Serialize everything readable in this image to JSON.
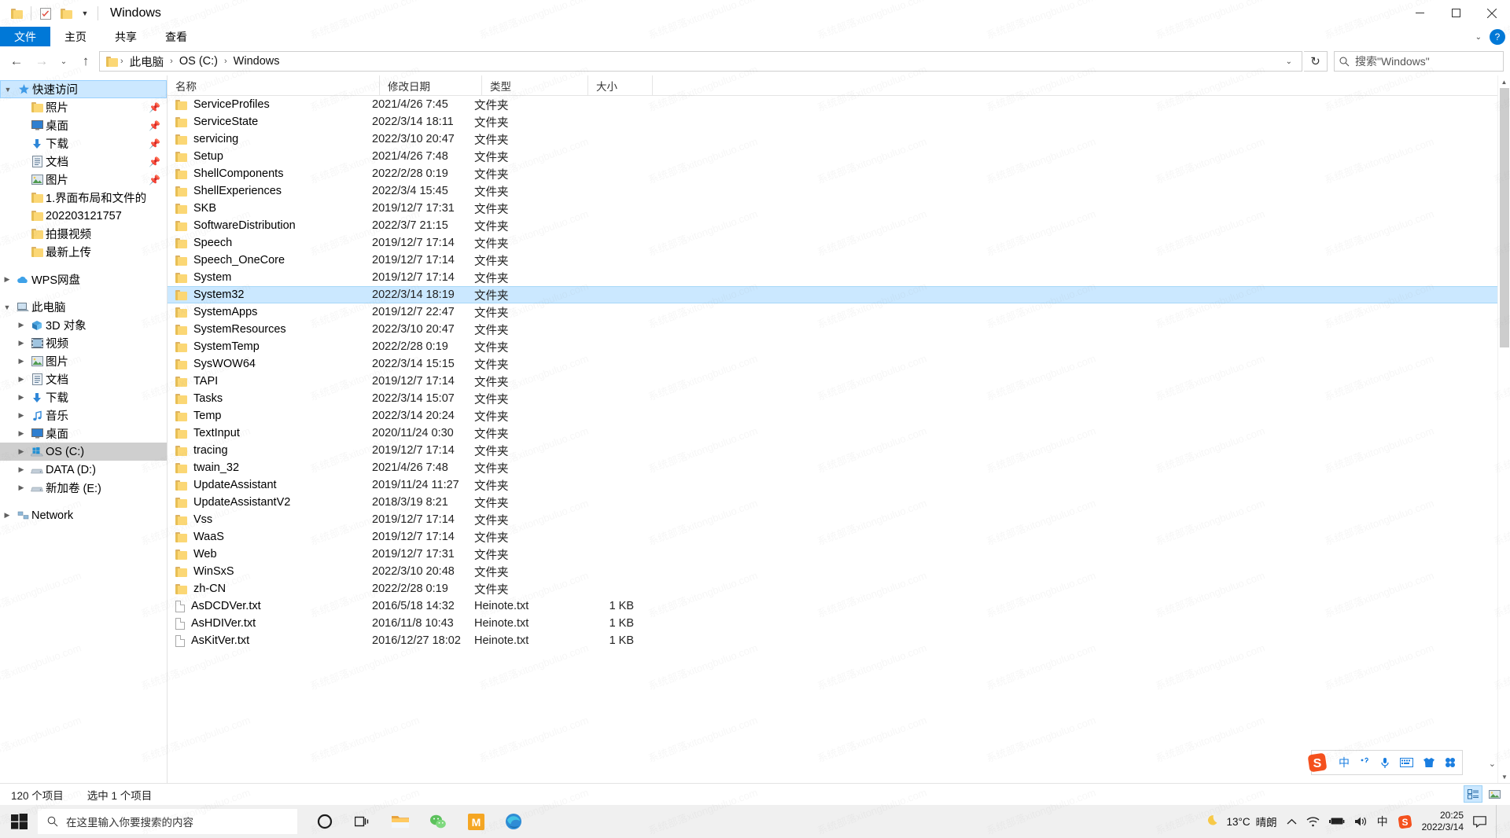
{
  "window": {
    "title": "Windows",
    "quick_access_toolbar": [
      {
        "name": "properties-icon",
        "glyph": "folder"
      },
      {
        "name": "new-folder-icon",
        "glyph": "checklist"
      },
      {
        "name": "folder-icon",
        "glyph": "folder"
      }
    ],
    "controls": {
      "minimize": "─",
      "maximize": "☐",
      "close": "✕"
    }
  },
  "ribbon": {
    "tabs": [
      {
        "label": "文件",
        "active": true
      },
      {
        "label": "主页",
        "active": false
      },
      {
        "label": "共享",
        "active": false
      },
      {
        "label": "查看",
        "active": false
      }
    ],
    "collapse_glyph": "⌄",
    "help_glyph": "?"
  },
  "address": {
    "back": "←",
    "forward": "→",
    "recent": "⌄",
    "up": "↑",
    "breadcrumbs": [
      "此电脑",
      "OS (C:)",
      "Windows"
    ],
    "separator": "›",
    "dropdown": "⌄",
    "refresh": "↻",
    "search_placeholder": "搜索\"Windows\""
  },
  "sidebar": {
    "groups": [
      {
        "name": "quick-access",
        "label": "快速访问",
        "icon": "star-icon",
        "expanded": true,
        "selected": true,
        "items": [
          {
            "label": "照片",
            "icon": "folder-icon",
            "pinned": true
          },
          {
            "label": "桌面",
            "icon": "desktop-icon",
            "pinned": true
          },
          {
            "label": "下载",
            "icon": "download-icon",
            "pinned": true
          },
          {
            "label": "文档",
            "icon": "document-icon",
            "pinned": true
          },
          {
            "label": "图片",
            "icon": "pictures-icon",
            "pinned": true
          },
          {
            "label": "1.界面布局和文件的",
            "icon": "folder-icon",
            "pinned": false
          },
          {
            "label": "202203121757",
            "icon": "folder-icon",
            "pinned": false
          },
          {
            "label": "拍摄视频",
            "icon": "folder-icon",
            "pinned": false
          },
          {
            "label": "最新上传",
            "icon": "folder-icon",
            "pinned": false
          }
        ]
      },
      {
        "name": "wps-cloud",
        "label": "WPS网盘",
        "icon": "cloud-icon",
        "expanded": false,
        "items": []
      },
      {
        "name": "this-pc",
        "label": "此电脑",
        "icon": "computer-icon",
        "expanded": true,
        "items": [
          {
            "label": "3D 对象",
            "icon": "3d-objects-icon",
            "chevron": true
          },
          {
            "label": "视频",
            "icon": "videos-icon",
            "chevron": true
          },
          {
            "label": "图片",
            "icon": "pictures-icon",
            "chevron": true
          },
          {
            "label": "文档",
            "icon": "document-icon",
            "chevron": true
          },
          {
            "label": "下载",
            "icon": "download-icon",
            "chevron": true
          },
          {
            "label": "音乐",
            "icon": "music-icon",
            "chevron": true
          },
          {
            "label": "桌面",
            "icon": "desktop-icon",
            "chevron": true
          },
          {
            "label": "OS (C:)",
            "icon": "windows-drive-icon",
            "chevron": true,
            "selected": true
          },
          {
            "label": "DATA (D:)",
            "icon": "drive-icon",
            "chevron": true
          },
          {
            "label": "新加卷 (E:)",
            "icon": "drive-icon",
            "chevron": true
          }
        ]
      },
      {
        "name": "network",
        "label": "Network",
        "icon": "network-icon",
        "expanded": false,
        "items": []
      }
    ]
  },
  "filelist": {
    "columns": [
      {
        "key": "name",
        "label": "名称",
        "sorted": true,
        "sort_dir": "asc"
      },
      {
        "key": "date",
        "label": "修改日期"
      },
      {
        "key": "type",
        "label": "类型"
      },
      {
        "key": "size",
        "label": "大小"
      }
    ],
    "sort_glyph": "▲",
    "rows": [
      {
        "name": "ServiceProfiles",
        "date": "2021/4/26 7:45",
        "type": "文件夹",
        "size": "",
        "kind": "folder"
      },
      {
        "name": "ServiceState",
        "date": "2022/3/14 18:11",
        "type": "文件夹",
        "size": "",
        "kind": "folder"
      },
      {
        "name": "servicing",
        "date": "2022/3/10 20:47",
        "type": "文件夹",
        "size": "",
        "kind": "folder"
      },
      {
        "name": "Setup",
        "date": "2021/4/26 7:48",
        "type": "文件夹",
        "size": "",
        "kind": "folder"
      },
      {
        "name": "ShellComponents",
        "date": "2022/2/28 0:19",
        "type": "文件夹",
        "size": "",
        "kind": "folder"
      },
      {
        "name": "ShellExperiences",
        "date": "2022/3/4 15:45",
        "type": "文件夹",
        "size": "",
        "kind": "folder"
      },
      {
        "name": "SKB",
        "date": "2019/12/7 17:31",
        "type": "文件夹",
        "size": "",
        "kind": "folder"
      },
      {
        "name": "SoftwareDistribution",
        "date": "2022/3/7 21:15",
        "type": "文件夹",
        "size": "",
        "kind": "folder"
      },
      {
        "name": "Speech",
        "date": "2019/12/7 17:14",
        "type": "文件夹",
        "size": "",
        "kind": "folder"
      },
      {
        "name": "Speech_OneCore",
        "date": "2019/12/7 17:14",
        "type": "文件夹",
        "size": "",
        "kind": "folder"
      },
      {
        "name": "System",
        "date": "2019/12/7 17:14",
        "type": "文件夹",
        "size": "",
        "kind": "folder"
      },
      {
        "name": "System32",
        "date": "2022/3/14 18:19",
        "type": "文件夹",
        "size": "",
        "kind": "folder",
        "selected": true
      },
      {
        "name": "SystemApps",
        "date": "2019/12/7 22:47",
        "type": "文件夹",
        "size": "",
        "kind": "folder"
      },
      {
        "name": "SystemResources",
        "date": "2022/3/10 20:47",
        "type": "文件夹",
        "size": "",
        "kind": "folder"
      },
      {
        "name": "SystemTemp",
        "date": "2022/2/28 0:19",
        "type": "文件夹",
        "size": "",
        "kind": "folder"
      },
      {
        "name": "SysWOW64",
        "date": "2022/3/14 15:15",
        "type": "文件夹",
        "size": "",
        "kind": "folder"
      },
      {
        "name": "TAPI",
        "date": "2019/12/7 17:14",
        "type": "文件夹",
        "size": "",
        "kind": "folder"
      },
      {
        "name": "Tasks",
        "date": "2022/3/14 15:07",
        "type": "文件夹",
        "size": "",
        "kind": "folder"
      },
      {
        "name": "Temp",
        "date": "2022/3/14 20:24",
        "type": "文件夹",
        "size": "",
        "kind": "folder"
      },
      {
        "name": "TextInput",
        "date": "2020/11/24 0:30",
        "type": "文件夹",
        "size": "",
        "kind": "folder"
      },
      {
        "name": "tracing",
        "date": "2019/12/7 17:14",
        "type": "文件夹",
        "size": "",
        "kind": "folder"
      },
      {
        "name": "twain_32",
        "date": "2021/4/26 7:48",
        "type": "文件夹",
        "size": "",
        "kind": "folder"
      },
      {
        "name": "UpdateAssistant",
        "date": "2019/11/24 11:27",
        "type": "文件夹",
        "size": "",
        "kind": "folder"
      },
      {
        "name": "UpdateAssistantV2",
        "date": "2018/3/19 8:21",
        "type": "文件夹",
        "size": "",
        "kind": "folder"
      },
      {
        "name": "Vss",
        "date": "2019/12/7 17:14",
        "type": "文件夹",
        "size": "",
        "kind": "folder"
      },
      {
        "name": "WaaS",
        "date": "2019/12/7 17:14",
        "type": "文件夹",
        "size": "",
        "kind": "folder"
      },
      {
        "name": "Web",
        "date": "2019/12/7 17:31",
        "type": "文件夹",
        "size": "",
        "kind": "folder"
      },
      {
        "name": "WinSxS",
        "date": "2022/3/10 20:48",
        "type": "文件夹",
        "size": "",
        "kind": "folder"
      },
      {
        "name": "zh-CN",
        "date": "2022/2/28 0:19",
        "type": "文件夹",
        "size": "",
        "kind": "folder"
      },
      {
        "name": "AsDCDVer.txt",
        "date": "2016/5/18 14:32",
        "type": "Heinote.txt",
        "size": "1 KB",
        "kind": "txt"
      },
      {
        "name": "AsHDIVer.txt",
        "date": "2016/11/8 10:43",
        "type": "Heinote.txt",
        "size": "1 KB",
        "kind": "txt"
      },
      {
        "name": "AsKitVer.txt",
        "date": "2016/12/27 18:02",
        "type": "Heinote.txt",
        "size": "1 KB",
        "kind": "txt"
      }
    ]
  },
  "statusbar": {
    "item_count": "120 个项目",
    "selection": "选中 1 个项目",
    "view_details": "details-view-icon",
    "view_thumbs": "thumbnail-view-icon"
  },
  "ime": {
    "logo": "S",
    "buttons": [
      {
        "name": "chinese-mode-icon",
        "glyph": "中"
      },
      {
        "name": "punctuation-icon",
        "glyph": "，"
      },
      {
        "name": "microphone-icon",
        "glyph": "🎙"
      },
      {
        "name": "keyboard-icon",
        "glyph": "⌨"
      },
      {
        "name": "skin-icon",
        "glyph": "👕"
      },
      {
        "name": "toolbox-icon",
        "glyph": "∷"
      }
    ],
    "collapse": "⌄"
  },
  "taskbar": {
    "start_icon": "windows-start-icon",
    "search_placeholder": "在这里输入你要搜索的内容",
    "pinned": [
      {
        "name": "cortana-icon",
        "glyph": "O"
      },
      {
        "name": "task-view-icon",
        "glyph": "⌸"
      },
      {
        "name": "file-explorer-icon",
        "glyph": "folder"
      },
      {
        "name": "wechat-icon",
        "glyph": "wechat"
      },
      {
        "name": "mark-app-icon",
        "glyph": "M"
      },
      {
        "name": "edge-icon",
        "glyph": "edge"
      }
    ],
    "weather": {
      "icon": "moon-icon",
      "temperature": "13°C",
      "condition": "晴朗"
    },
    "tray": [
      {
        "name": "show-hidden-icons-icon",
        "glyph": "⌃"
      },
      {
        "name": "wifi-icon",
        "glyph": "wifi"
      },
      {
        "name": "battery-icon",
        "glyph": "battery"
      },
      {
        "name": "volume-icon",
        "glyph": "volume"
      },
      {
        "name": "ime-indicator-icon",
        "glyph": "中"
      },
      {
        "name": "sogou-tray-icon",
        "glyph": "S"
      }
    ],
    "clock": {
      "time": "20:25",
      "date": "2022/3/14"
    },
    "notification_icon": "notification-icon"
  },
  "watermark": "系统部落xitongbuluo.com"
}
